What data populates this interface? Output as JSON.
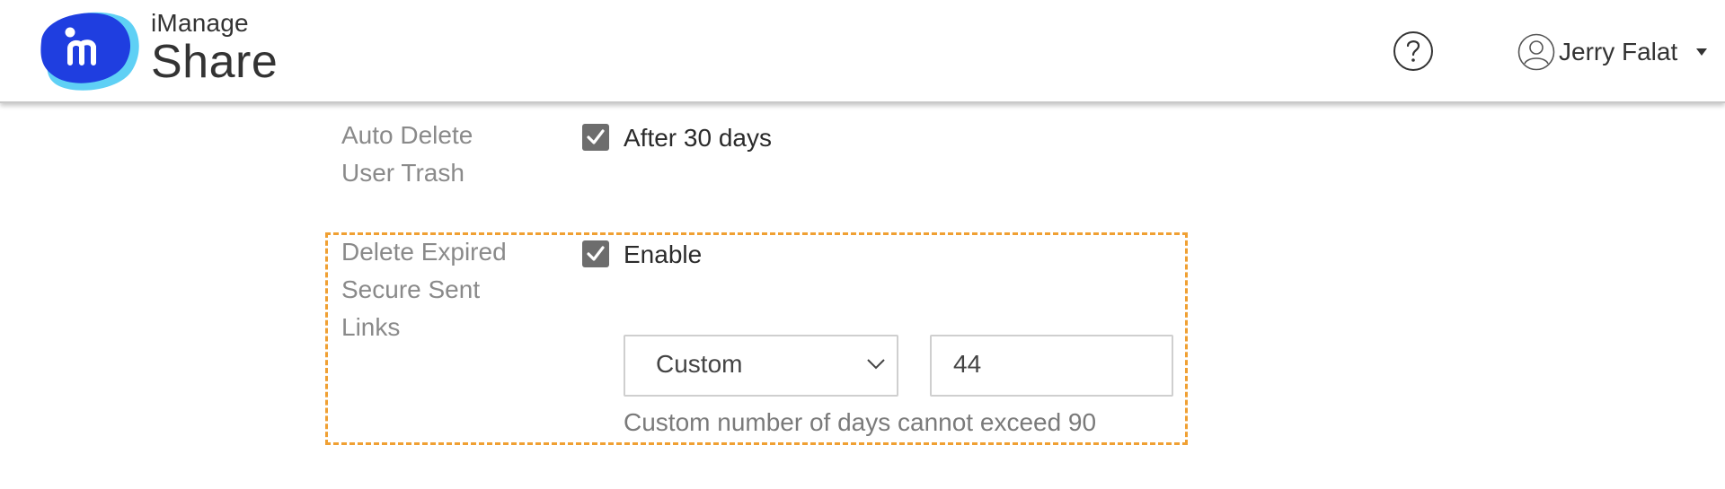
{
  "header": {
    "brand_line1": "iManage",
    "brand_line2": "Share",
    "user_name": "Jerry Falat",
    "colors": {
      "logo_primary": "#1f3ee0",
      "logo_accent": "#5fd0f5"
    }
  },
  "settings": {
    "auto_delete_trash": {
      "label_line1": "Auto Delete",
      "label_line2": "User Trash",
      "checked": true,
      "check_label": "After 30 days"
    },
    "delete_expired_links": {
      "label_line1": "Delete Expired",
      "label_line2": "Secure Sent",
      "label_line3": "Links",
      "checked": true,
      "check_label": "Enable",
      "period_select": "Custom",
      "days_value": "44",
      "helper_text": "Custom number of days cannot exceed 90",
      "highlight_color": "#f0a033"
    }
  }
}
